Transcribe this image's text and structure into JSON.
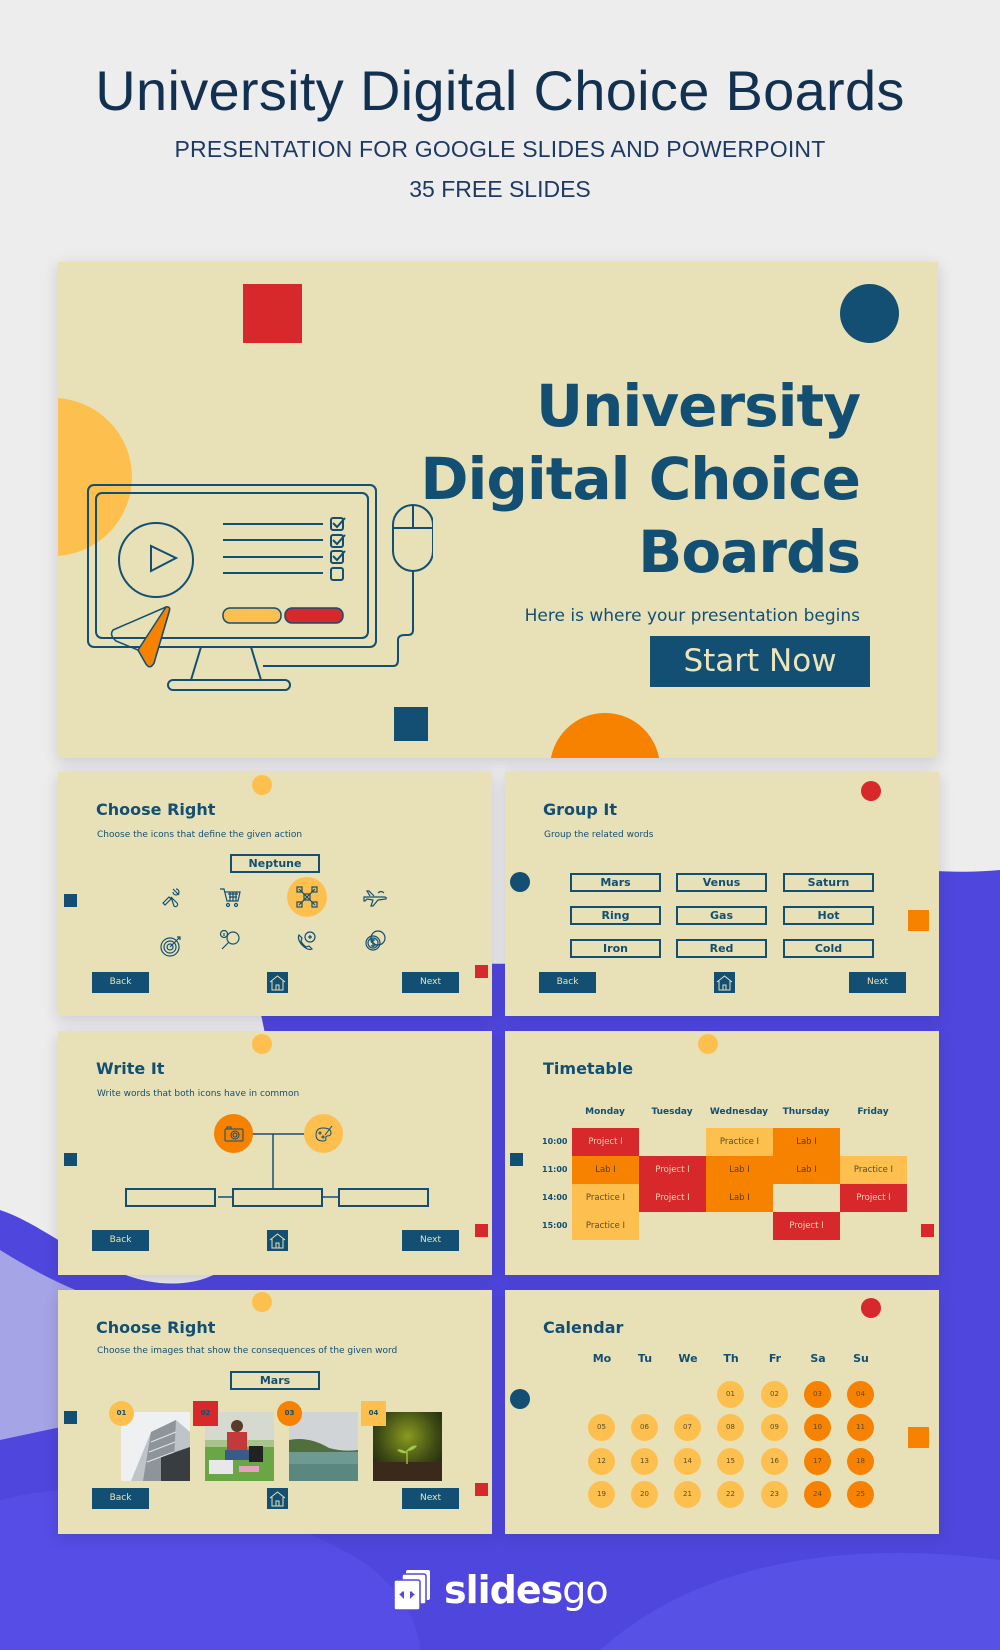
{
  "header": {
    "title": "University Digital Choice Boards",
    "subtitle": "PRESENTATION FOR GOOGLE SLIDES AND POWERPOINT",
    "slide_count": "35 FREE SLIDES"
  },
  "colors": {
    "slide_bg": "#e8e1b8",
    "navy": "#124f72",
    "red": "#d7282b",
    "orange": "#f68200",
    "yellow": "#fdc04e",
    "purple": "#5048e0"
  },
  "cover": {
    "title_lines": [
      "University",
      "Digital Choice",
      "Boards"
    ],
    "tagline": "Here is where your presentation begins",
    "start_label": "Start Now"
  },
  "slides": {
    "choose_icons": {
      "title": "Choose Right",
      "description": "Choose the icons that define the given action",
      "word": "Neptune",
      "icons": [
        "tools-icon",
        "shopping-cart-icon",
        "teamwork-icon",
        "airplane-icon",
        "target-icon",
        "search-info-icon",
        "phone-call-icon",
        "coins-icon"
      ],
      "selected_icon": "teamwork-icon"
    },
    "group_it": {
      "title": "Group It",
      "description": "Group the related words",
      "words": [
        "Mars",
        "Venus",
        "Saturn",
        "Ring",
        "Gas",
        "Hot",
        "Iron",
        "Red",
        "Cold"
      ]
    },
    "write_it": {
      "title": "Write It",
      "description": "Write words that both icons have in common",
      "icons": [
        "camera-icon",
        "palette-icon"
      ]
    },
    "timetable": {
      "title": "Timetable",
      "days": [
        "Monday",
        "Tuesday",
        "Wednesday",
        "Thursday",
        "Friday"
      ],
      "times": [
        "10:00",
        "11:00",
        "14:00",
        "15:00"
      ],
      "rows": [
        [
          "Project I",
          "",
          "Practice I",
          "Lab I",
          ""
        ],
        [
          "Lab I",
          "Project I",
          "Lab I",
          "Lab I",
          "Practice I"
        ],
        [
          "Practice I",
          "Project I",
          "Lab I",
          "",
          "Project I"
        ],
        [
          "Practice I",
          "",
          "",
          "Project I",
          ""
        ]
      ]
    },
    "choose_images": {
      "title": "Choose Right",
      "description": "Choose the images that show the consequences of the given word",
      "word": "Mars",
      "images": [
        {
          "badge": "01",
          "subject": "glass building"
        },
        {
          "badge": "02",
          "subject": "student on grass"
        },
        {
          "badge": "03",
          "subject": "lake landscape"
        },
        {
          "badge": "04",
          "subject": "seedling sprout"
        }
      ]
    },
    "calendar": {
      "title": "Calendar",
      "weekdays": [
        "Mo",
        "Tu",
        "We",
        "Th",
        "Fr",
        "Sa",
        "Su"
      ],
      "days": [
        "01",
        "02",
        "03",
        "04",
        "05",
        "06",
        "07",
        "08",
        "09",
        "10",
        "11",
        "12",
        "13",
        "14",
        "15",
        "16",
        "17",
        "18",
        "19",
        "20",
        "21",
        "22",
        "23",
        "24",
        "25"
      ]
    }
  },
  "nav": {
    "back_label": "Back",
    "next_label": "Next"
  },
  "brand": {
    "name_bold": "slides",
    "name_light": "go"
  }
}
